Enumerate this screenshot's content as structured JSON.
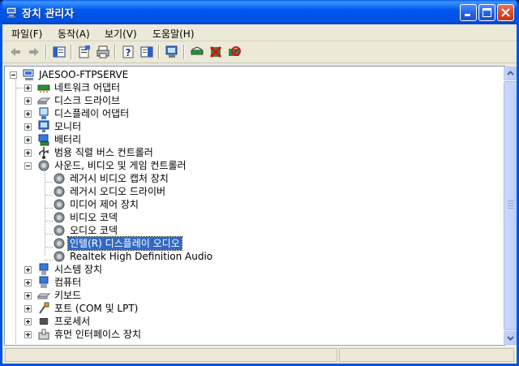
{
  "window": {
    "title": "장치 관리자"
  },
  "menu": [
    {
      "label": "파일(F)"
    },
    {
      "label": "동작(A)"
    },
    {
      "label": "보기(V)"
    },
    {
      "label": "도움말(H)"
    }
  ],
  "toolbar": {
    "icons": [
      "back-arrow-icon",
      "forward-arrow-icon",
      "show-hide-tree-icon",
      "properties-icon",
      "print-icon",
      "help-icon",
      "view-icon",
      "scan-hardware-icon",
      "update-driver-icon",
      "uninstall-icon",
      "disable-icon"
    ]
  },
  "tree": {
    "root": {
      "label": "JAESOO-FTPSERVE"
    },
    "categories": [
      {
        "label": "네트워크 어댑터",
        "icon": "network-adapter-icon",
        "expanded": false
      },
      {
        "label": "디스크 드라이브",
        "icon": "disk-drive-icon",
        "expanded": false
      },
      {
        "label": "디스플레이 어댑터",
        "icon": "display-adapter-icon",
        "expanded": false
      },
      {
        "label": "모니터",
        "icon": "monitor-icon",
        "expanded": false
      },
      {
        "label": "배터리",
        "icon": "battery-icon",
        "expanded": false
      },
      {
        "label": "범용 직렬 버스 컨트롤러",
        "icon": "usb-controller-icon",
        "expanded": false
      },
      {
        "label": "사운드, 비디오 및 게임 컨트롤러",
        "icon": "sound-controller-icon",
        "expanded": true
      },
      {
        "label": "시스템 장치",
        "icon": "system-device-icon",
        "expanded": false
      },
      {
        "label": "컴퓨터",
        "icon": "computer-icon",
        "expanded": false
      },
      {
        "label": "키보드",
        "icon": "keyboard-icon",
        "expanded": false
      },
      {
        "label": "포트 (COM 및 LPT)",
        "icon": "port-icon",
        "expanded": false
      },
      {
        "label": "프로세서",
        "icon": "processor-icon",
        "expanded": false
      },
      {
        "label": "휴먼 인터페이스 장치",
        "icon": "hid-icon",
        "expanded": false
      }
    ],
    "sound_children": [
      {
        "label": "레거시 비디오 캡처 장치"
      },
      {
        "label": "레거시 오디오 드라이버"
      },
      {
        "label": "미디어 제어 장치"
      },
      {
        "label": "비디오 코덱"
      },
      {
        "label": "오디오 코덱"
      },
      {
        "label": "인텔(R) 디스플레이 오디오",
        "selected": true
      },
      {
        "label": "Realtek High Definition Audio"
      }
    ]
  },
  "colors": {
    "title_bar": "#0058ee",
    "selection": "#316ac5",
    "close_button": "#d8461f"
  }
}
